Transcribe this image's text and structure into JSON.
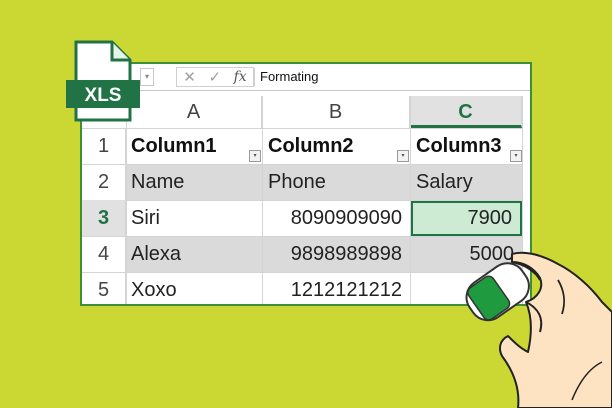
{
  "file_badge": "XLS",
  "formula_bar": {
    "dropdown_glyph": "▾",
    "cancel_glyph": "✕",
    "confirm_glyph": "✓",
    "fx_label": "fx",
    "content": "Formating"
  },
  "columns": [
    "A",
    "B",
    "C"
  ],
  "rows": [
    {
      "num": "1",
      "cells": [
        "Column1",
        "Column2",
        "Column3"
      ]
    },
    {
      "num": "2",
      "cells": [
        "Name",
        "Phone",
        "Salary"
      ]
    },
    {
      "num": "3",
      "cells": [
        "Siri",
        "8090909090",
        "7900"
      ]
    },
    {
      "num": "4",
      "cells": [
        "Alexa",
        "9898989898",
        "5000"
      ]
    },
    {
      "num": "5",
      "cells": [
        "Xoxo",
        "1212121212",
        ""
      ]
    }
  ],
  "filter_glyph": "▾",
  "colors": {
    "background": "#cbd834",
    "excel_green": "#217346",
    "active_cell_fill": "#cdebd2",
    "border_green": "#3d8f3a"
  },
  "icons": [
    "xls-file-icon",
    "fx-icon",
    "cancel-icon",
    "confirm-icon",
    "eraser-icon",
    "hand-illustration"
  ]
}
